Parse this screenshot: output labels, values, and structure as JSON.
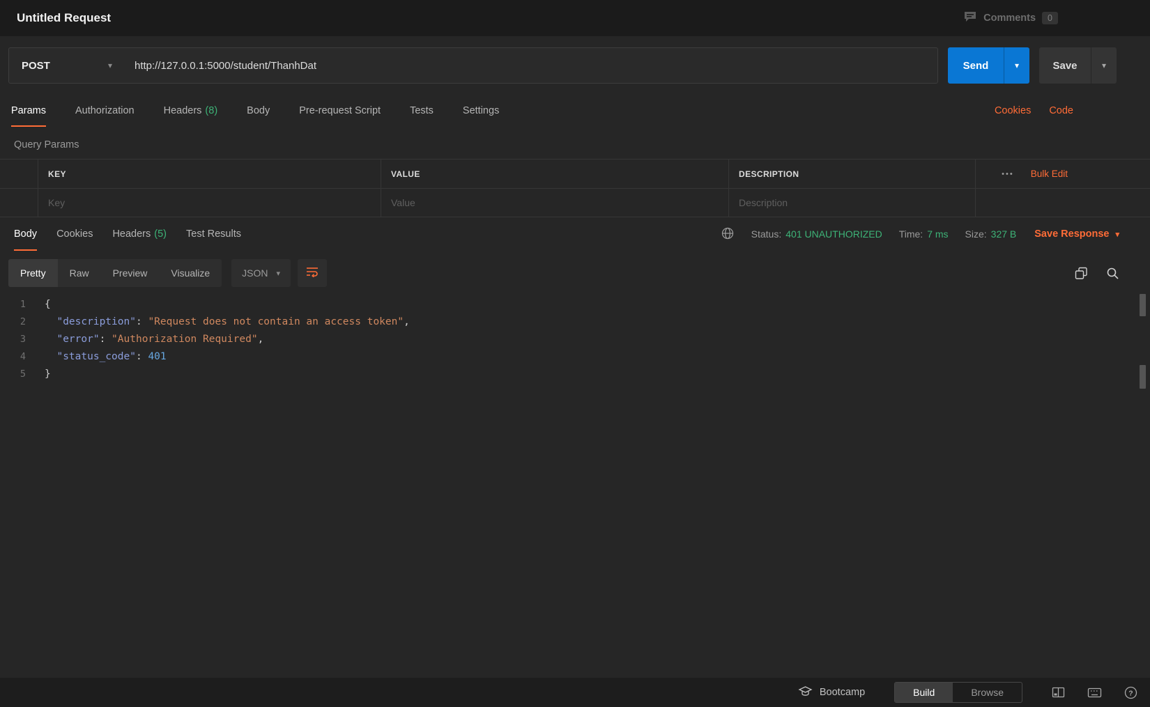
{
  "colors": {
    "accent": "#ff6c37",
    "send_blue": "#0a77d4",
    "success_green": "#3db377",
    "background": "#262626"
  },
  "header": {
    "title": "Untitled Request",
    "comments_label": "Comments",
    "comments_count": "0"
  },
  "request": {
    "method": "POST",
    "url": "http://127.0.0.1:5000/student/ThanhDat",
    "send_label": "Send",
    "save_label": "Save"
  },
  "request_tabs": {
    "items": [
      {
        "label": "Params",
        "active": true
      },
      {
        "label": "Authorization"
      },
      {
        "label": "Headers",
        "count": "(8)"
      },
      {
        "label": "Body"
      },
      {
        "label": "Pre-request Script"
      },
      {
        "label": "Tests"
      },
      {
        "label": "Settings"
      }
    ],
    "cookies_link": "Cookies",
    "code_link": "Code"
  },
  "query_params": {
    "title": "Query Params",
    "columns": {
      "key": "KEY",
      "value": "VALUE",
      "description": "DESCRIPTION"
    },
    "more_label": "•••",
    "bulk_edit_label": "Bulk Edit",
    "row_placeholders": {
      "key": "Key",
      "value": "Value",
      "description": "Description"
    }
  },
  "response": {
    "tabs": [
      {
        "label": "Body",
        "active": true
      },
      {
        "label": "Cookies"
      },
      {
        "label": "Headers",
        "count": "(5)"
      },
      {
        "label": "Test Results"
      }
    ],
    "status_label": "Status:",
    "status_value": "401 UNAUTHORIZED",
    "time_label": "Time:",
    "time_value": "7 ms",
    "size_label": "Size:",
    "size_value": "327 B",
    "save_response_label": "Save Response",
    "view_tabs": [
      {
        "label": "Pretty",
        "active": true
      },
      {
        "label": "Raw"
      },
      {
        "label": "Preview"
      },
      {
        "label": "Visualize"
      }
    ],
    "format_selected": "JSON"
  },
  "code": {
    "lines": [
      {
        "num": "1",
        "tokens": [
          {
            "t": "{",
            "c": "punct"
          }
        ]
      },
      {
        "num": "2",
        "tokens": [
          {
            "t": "  ",
            "c": "punct"
          },
          {
            "t": "\"description\"",
            "c": "key"
          },
          {
            "t": ": ",
            "c": "punct"
          },
          {
            "t": "\"Request does not contain an access token\"",
            "c": "string"
          },
          {
            "t": ",",
            "c": "punct"
          }
        ]
      },
      {
        "num": "3",
        "tokens": [
          {
            "t": "  ",
            "c": "punct"
          },
          {
            "t": "\"error\"",
            "c": "key"
          },
          {
            "t": ": ",
            "c": "punct"
          },
          {
            "t": "\"Authorization Required\"",
            "c": "string"
          },
          {
            "t": ",",
            "c": "punct"
          }
        ]
      },
      {
        "num": "4",
        "tokens": [
          {
            "t": "  ",
            "c": "punct"
          },
          {
            "t": "\"status_code\"",
            "c": "key"
          },
          {
            "t": ": ",
            "c": "punct"
          },
          {
            "t": "401",
            "c": "number"
          }
        ]
      },
      {
        "num": "5",
        "tokens": [
          {
            "t": "}",
            "c": "punct"
          }
        ]
      }
    ]
  },
  "footer": {
    "bootcamp_label": "Bootcamp",
    "build_label": "Build",
    "browse_label": "Browse"
  }
}
